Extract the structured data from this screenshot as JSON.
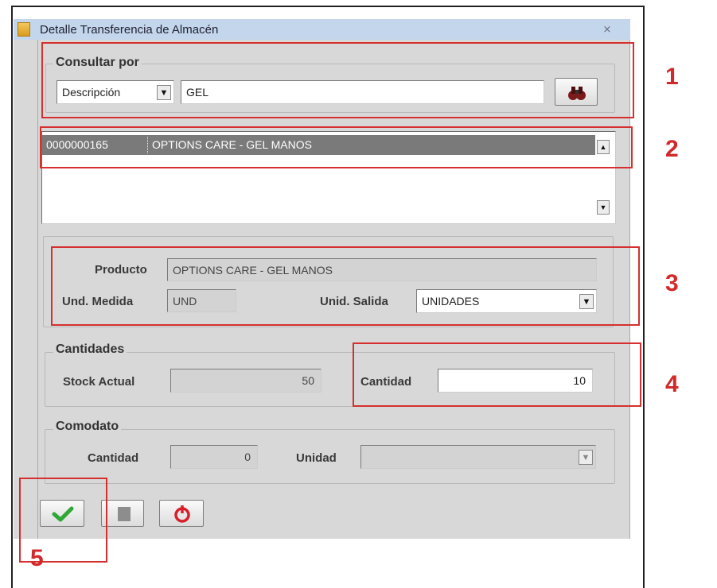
{
  "window": {
    "title": "Detalle Transferencia de Almacén",
    "close_glyph": "⨯"
  },
  "consultar": {
    "legend": "Consultar por",
    "criteria_value": "Descripción",
    "search_value": "GEL"
  },
  "results": {
    "rows": [
      {
        "code": "0000000165",
        "description": "OPTIONS CARE - GEL MANOS"
      }
    ]
  },
  "producto": {
    "producto_label": "Producto",
    "producto_value": "OPTIONS CARE - GEL MANOS",
    "und_medida_label": "Und. Medida",
    "und_medida_value": "UND",
    "unid_salida_label": "Unid. Salida",
    "unid_salida_value": "UNIDADES"
  },
  "cantidades": {
    "legend": "Cantidades",
    "stock_label": "Stock Actual",
    "stock_value": "50",
    "cantidad_label": "Cantidad",
    "cantidad_value": "10"
  },
  "comodato": {
    "legend": "Comodato",
    "cantidad_label": "Cantidad",
    "cantidad_value": "0",
    "unidad_label": "Unidad",
    "unidad_value": ""
  },
  "annotations": [
    "1",
    "2",
    "3",
    "4",
    "5"
  ],
  "colors": {
    "annotation": "#d62f2f",
    "selection": "#7a7a7a",
    "window_bg": "#d8d8d8"
  },
  "icons": [
    "binoculars-icon",
    "check-icon",
    "stop-icon",
    "power-icon"
  ]
}
